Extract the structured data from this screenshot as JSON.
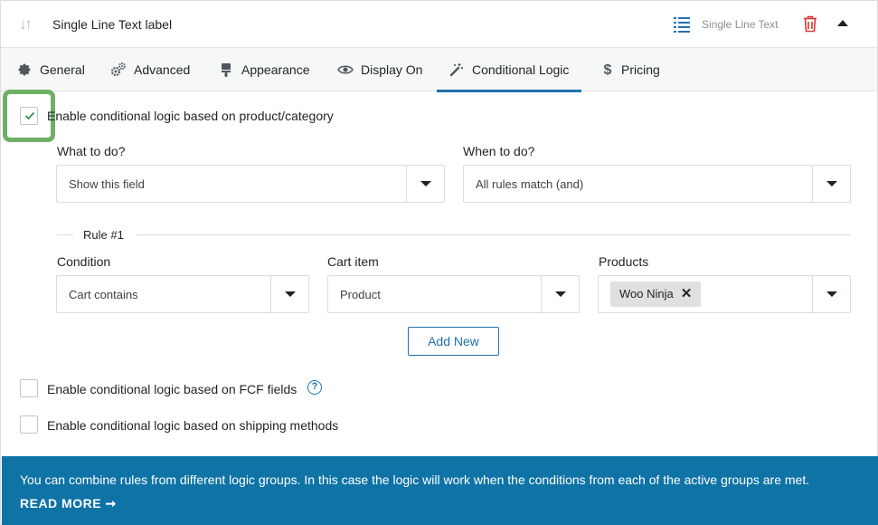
{
  "header": {
    "field_label": "Single Line Text label",
    "field_type": "Single Line Text"
  },
  "tabs": [
    {
      "label": "General",
      "icon": "gear-icon"
    },
    {
      "label": "Advanced",
      "icon": "gears-icon"
    },
    {
      "label": "Appearance",
      "icon": "paint-brush-icon"
    },
    {
      "label": "Display On",
      "icon": "eye-icon"
    },
    {
      "label": "Conditional Logic",
      "icon": "magic-wand-icon",
      "active": true
    },
    {
      "label": "Pricing",
      "icon": "dollar-icon"
    }
  ],
  "conditional": {
    "product_category": {
      "label": "Enable conditional logic based on product/category",
      "checked": true
    },
    "what_to_do": {
      "label": "What to do?",
      "value": "Show this field"
    },
    "when_to_do": {
      "label": "When to do?",
      "value": "All rules match (and)"
    },
    "rule": {
      "title": "Rule #1",
      "condition": {
        "label": "Condition",
        "value": "Cart contains"
      },
      "cart_item": {
        "label": "Cart item",
        "value": "Product"
      },
      "products": {
        "label": "Products",
        "selected": [
          "Woo Ninja"
        ]
      }
    },
    "add_new_label": "Add New",
    "fcf_fields": {
      "label": "Enable conditional logic based on FCF fields",
      "checked": false
    },
    "shipping": {
      "label": "Enable conditional logic based on shipping methods",
      "checked": false
    }
  },
  "notice": {
    "text": "You can combine rules from different logic groups. In this case the logic will work when the conditions from each of the active groups are met.",
    "link": "READ MORE ➞"
  },
  "colors": {
    "accent": "#2271b1",
    "notice_bg": "#0f73a6",
    "highlight": "#6fb066",
    "delete": "#d63638"
  }
}
